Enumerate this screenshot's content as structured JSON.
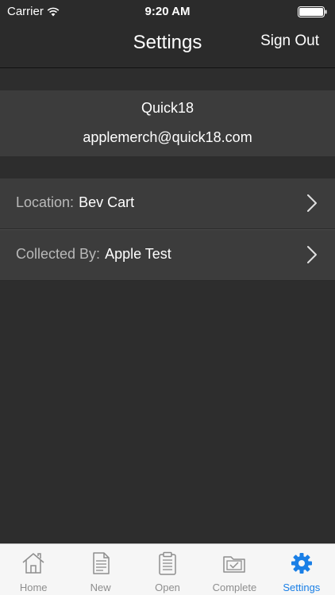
{
  "status_bar": {
    "carrier": "Carrier",
    "time": "9:20 AM"
  },
  "nav": {
    "title": "Settings",
    "sign_out": "Sign Out"
  },
  "account": {
    "name": "Quick18",
    "email": "applemerch@quick18.com"
  },
  "settings_rows": [
    {
      "label": "Location:",
      "value": "Bev Cart"
    },
    {
      "label": "Collected By:",
      "value": "Apple Test"
    }
  ],
  "tabs": [
    {
      "label": "Home",
      "icon": "home-icon"
    },
    {
      "label": "New",
      "icon": "document-icon"
    },
    {
      "label": "Open",
      "icon": "clipboard-icon"
    },
    {
      "label": "Complete",
      "icon": "folder-check-icon"
    },
    {
      "label": "Settings",
      "icon": "gear-icon",
      "active": true
    }
  ],
  "colors": {
    "accent": "#1a7fe6",
    "background": "#2d2d2d",
    "card": "#3c3c3c",
    "tab_inactive": "#8e8e8e"
  }
}
